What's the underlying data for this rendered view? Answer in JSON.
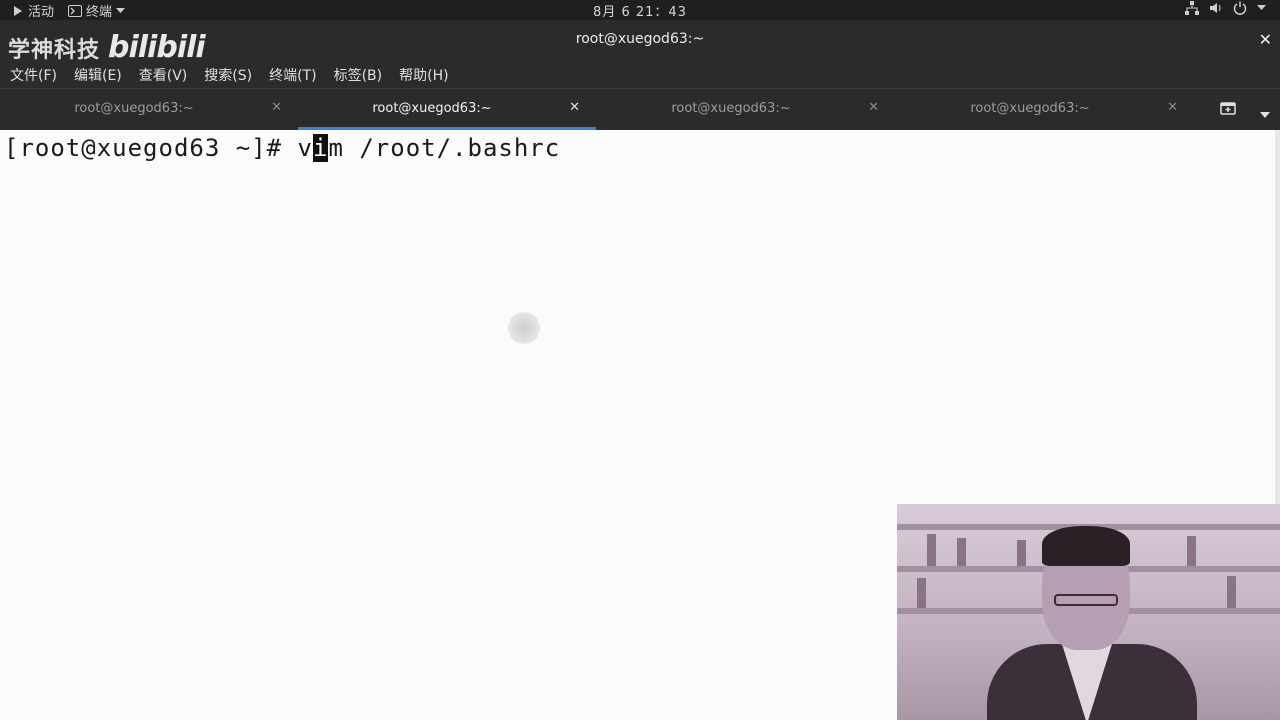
{
  "topbar": {
    "activities": "活动",
    "app_menu": "终端",
    "clock": "8月 6  21：43"
  },
  "titlebar": {
    "watermark_text": "学神科技",
    "watermark_logo": "bilibili",
    "title": "root@xuegod63:~",
    "close": "✕"
  },
  "menubar": {
    "items": [
      "文件(F)",
      "编辑(E)",
      "查看(V)",
      "搜索(S)",
      "终端(T)",
      "标签(B)",
      "帮助(H)"
    ]
  },
  "tabs": [
    {
      "label": "root@xuegod63:~",
      "active": false
    },
    {
      "label": "root@xuegod63:~",
      "active": true
    },
    {
      "label": "root@xuegod63:~",
      "active": false
    },
    {
      "label": "root@xuegod63:~",
      "active": false
    }
  ],
  "terminal": {
    "prompt": "[root@xuegod63 ~]# ",
    "cmd_before_cursor": "v",
    "cmd_cursor_char": "i",
    "cmd_after_cursor": "m /root/.bashrc"
  },
  "colors": {
    "accent": "#3d7fd6",
    "chrome": "#2b2b2b",
    "topbar": "#1f1f1f",
    "terminal_bg": "#fbfbfb"
  }
}
